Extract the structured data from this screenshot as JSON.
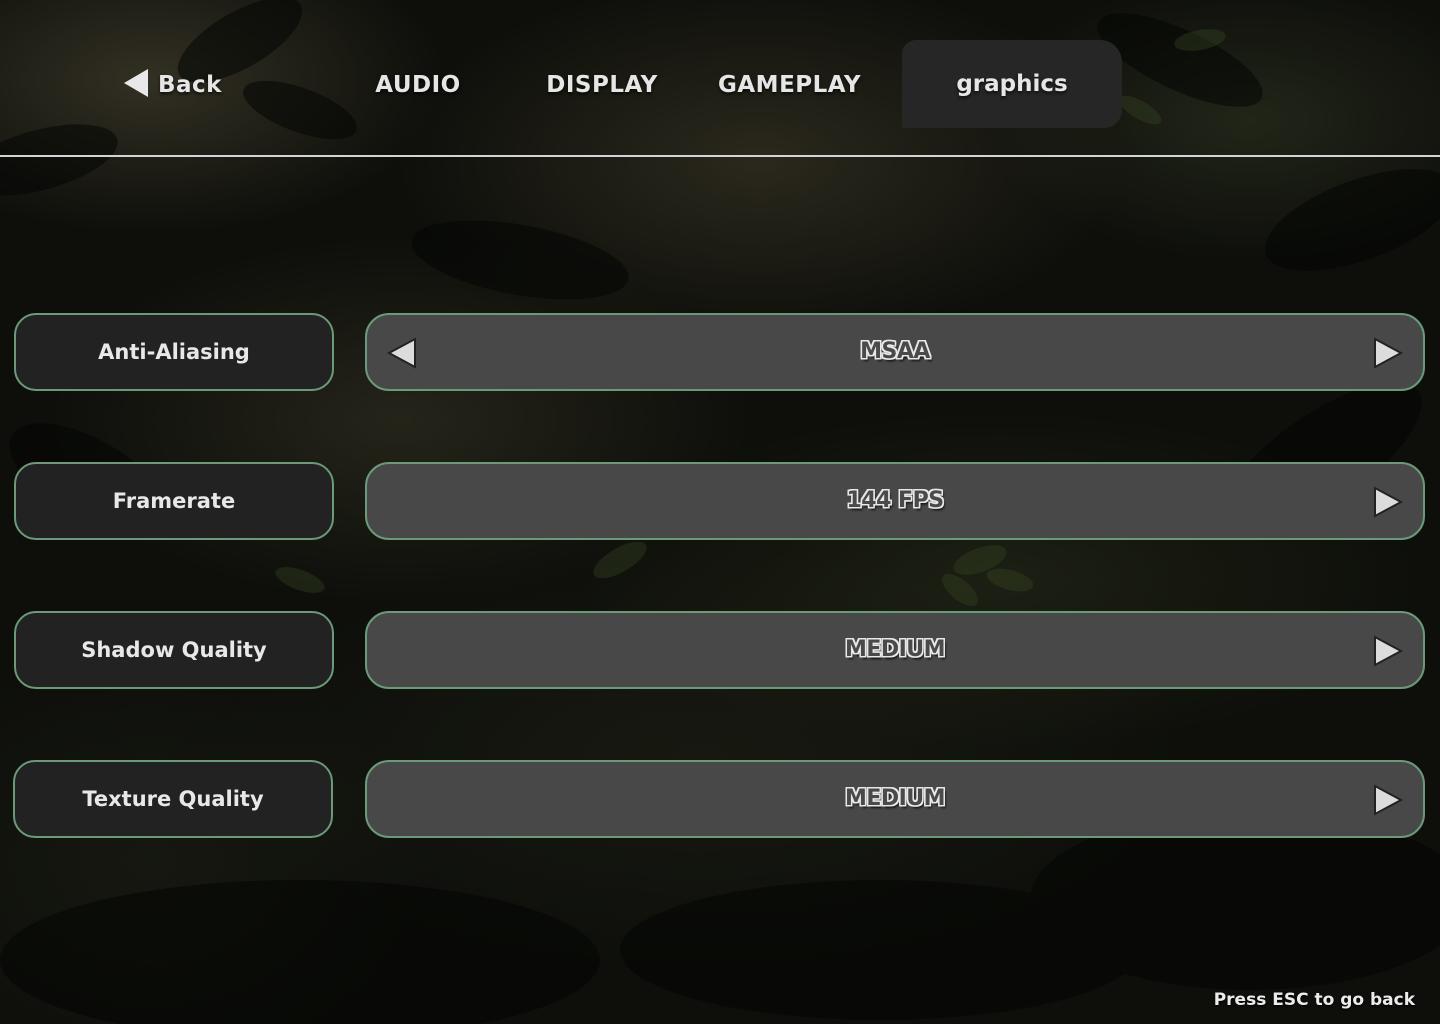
{
  "nav": {
    "back_label": "Back",
    "tabs": [
      {
        "label": "AUDIO"
      },
      {
        "label": "DISPLAY"
      },
      {
        "label": "GAMEPLAY"
      },
      {
        "label": "graphics",
        "active": true
      }
    ]
  },
  "settings": [
    {
      "label": "Anti-Aliasing",
      "value": "MSAA",
      "has_prev_arrow": true,
      "has_next_arrow": true
    },
    {
      "label": "Framerate",
      "value": "144 FPS",
      "has_prev_arrow": false,
      "has_next_arrow": true
    },
    {
      "label": "Shadow Quality",
      "value": "MEDIUM",
      "has_prev_arrow": false,
      "has_next_arrow": true
    },
    {
      "label": "Texture Quality",
      "value": "MEDIUM",
      "has_prev_arrow": false,
      "has_next_arrow": true
    }
  ],
  "footer": {
    "esc_hint": "Press ESC to go back"
  },
  "icons": {
    "back": "triangle-left-icon",
    "prev": "triangle-left-icon",
    "next": "triangle-right-icon"
  },
  "colors": {
    "accent_border": "#6a9a78",
    "label_bg": "#222222",
    "selector_bg": "#484848",
    "active_tab_bg": "#262626",
    "text": "#e8e8e8"
  }
}
